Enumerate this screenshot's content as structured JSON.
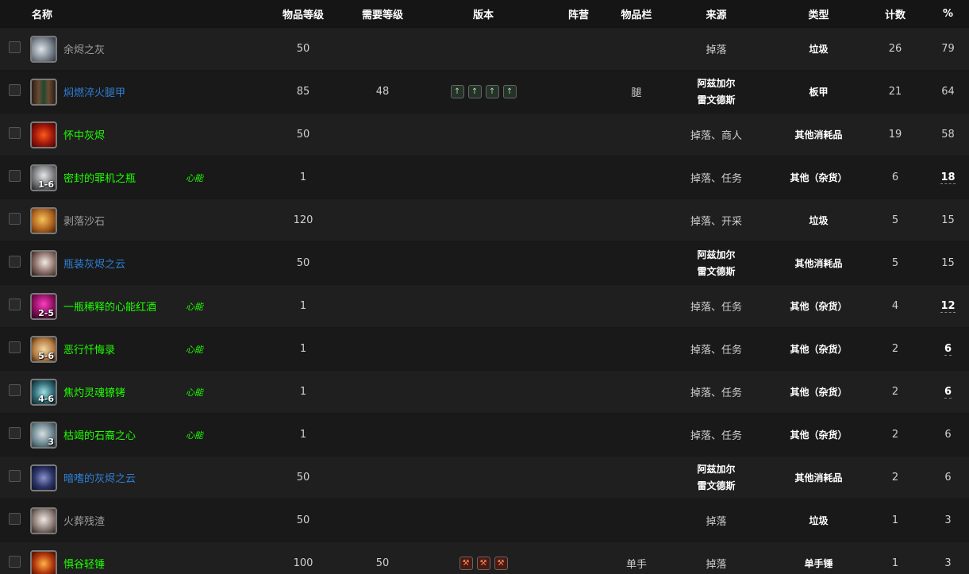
{
  "headers": {
    "name": "名称",
    "ilvl": "物品等级",
    "reqlvl": "需要等级",
    "version": "版本",
    "faction": "阵营",
    "slot": "物品栏",
    "source": "来源",
    "type": "类型",
    "count": "计数",
    "pct": "%"
  },
  "rows": [
    {
      "name": "余烬之灰",
      "quality": "poor",
      "icon": "ash-icon",
      "stack": "",
      "tag": "",
      "ilvl": "50",
      "reqlvl": "",
      "version_icons": [],
      "slot": "",
      "source": [
        "掉落"
      ],
      "type": "垃圾",
      "count": "26",
      "pct": "79",
      "pct_underlined": false
    },
    {
      "name": "焖燃淬火腿甲",
      "quality": "rare",
      "icon": "leg-armor-icon",
      "stack": "",
      "tag": "",
      "ilvl": "85",
      "reqlvl": "48",
      "version_icons": [
        "green",
        "green",
        "green",
        "green"
      ],
      "slot": "腿",
      "source": [
        "阿兹加尔",
        "雷文德斯"
      ],
      "type": "板甲",
      "count": "21",
      "pct": "64",
      "pct_underlined": false
    },
    {
      "name": "怀中灰烬",
      "quality": "uncommon",
      "icon": "ember-icon",
      "stack": "",
      "tag": "",
      "ilvl": "50",
      "reqlvl": "",
      "version_icons": [],
      "slot": "",
      "source": [
        "掉落、商人"
      ],
      "type": "其他消耗品",
      "count": "19",
      "pct": "58",
      "pct_underlined": false
    },
    {
      "name": "密封的罪机之瓶",
      "quality": "uncommon",
      "icon": "flask-icon",
      "stack": "1-6",
      "tag": "心能",
      "ilvl": "1",
      "reqlvl": "",
      "version_icons": [],
      "slot": "",
      "source": [
        "掉落、任务"
      ],
      "type": "其他（杂货）",
      "count": "6",
      "pct": "18",
      "pct_underlined": true
    },
    {
      "name": "剥落沙石",
      "quality": "poor",
      "icon": "sandstone-icon",
      "stack": "",
      "tag": "",
      "ilvl": "120",
      "reqlvl": "",
      "version_icons": [],
      "slot": "",
      "source": [
        "掉落、开采"
      ],
      "type": "垃圾",
      "count": "5",
      "pct": "15",
      "pct_underlined": false
    },
    {
      "name": "瓶装灰烬之云",
      "quality": "rare",
      "icon": "bottled-cloud-icon",
      "stack": "",
      "tag": "",
      "ilvl": "50",
      "reqlvl": "",
      "version_icons": [],
      "slot": "",
      "source": [
        "阿兹加尔",
        "雷文德斯"
      ],
      "type": "其他消耗品",
      "count": "5",
      "pct": "15",
      "pct_underlined": false
    },
    {
      "name": "一瓶稀释的心能红酒",
      "quality": "uncommon",
      "icon": "wine-bottle-icon",
      "stack": "2-5",
      "tag": "心能",
      "ilvl": "1",
      "reqlvl": "",
      "version_icons": [],
      "slot": "",
      "source": [
        "掉落、任务"
      ],
      "type": "其他（杂货）",
      "count": "4",
      "pct": "12",
      "pct_underlined": true
    },
    {
      "name": "恶行忏悔录",
      "quality": "uncommon",
      "icon": "scroll-icon",
      "stack": "5-6",
      "tag": "心能",
      "ilvl": "1",
      "reqlvl": "",
      "version_icons": [],
      "slot": "",
      "source": [
        "掉落、任务"
      ],
      "type": "其他（杂货）",
      "count": "2",
      "pct": "6",
      "pct_underlined": true
    },
    {
      "name": "焦灼灵魂镣铐",
      "quality": "uncommon",
      "icon": "shackle-icon",
      "stack": "4-6",
      "tag": "心能",
      "ilvl": "1",
      "reqlvl": "",
      "version_icons": [],
      "slot": "",
      "source": [
        "掉落、任务"
      ],
      "type": "其他（杂货）",
      "count": "2",
      "pct": "6",
      "pct_underlined": true
    },
    {
      "name": "枯竭的石裔之心",
      "quality": "uncommon",
      "icon": "stone-heart-icon",
      "stack": "3",
      "tag": "心能",
      "ilvl": "1",
      "reqlvl": "",
      "version_icons": [],
      "slot": "",
      "source": [
        "掉落、任务"
      ],
      "type": "其他（杂货）",
      "count": "2",
      "pct": "6",
      "pct_underlined": false
    },
    {
      "name": "暗嗜的灰烬之云",
      "quality": "rare",
      "icon": "dark-cloud-icon",
      "stack": "",
      "tag": "",
      "ilvl": "50",
      "reqlvl": "",
      "version_icons": [],
      "slot": "",
      "source": [
        "阿兹加尔",
        "雷文德斯"
      ],
      "type": "其他消耗品",
      "count": "2",
      "pct": "6",
      "pct_underlined": false
    },
    {
      "name": "火葬残渣",
      "quality": "poor",
      "icon": "remains-icon",
      "stack": "",
      "tag": "",
      "ilvl": "50",
      "reqlvl": "",
      "version_icons": [],
      "slot": "",
      "source": [
        "掉落"
      ],
      "type": "垃圾",
      "count": "1",
      "pct": "3",
      "pct_underlined": false
    },
    {
      "name": "惧谷轻锤",
      "quality": "uncommon",
      "icon": "hammer-icon",
      "stack": "",
      "tag": "",
      "ilvl": "100",
      "reqlvl": "50",
      "version_icons": [
        "red",
        "red",
        "red"
      ],
      "slot": "单手",
      "source": [
        "掉落"
      ],
      "type": "单手锤",
      "count": "1",
      "pct": "3",
      "pct_underlined": false
    }
  ]
}
